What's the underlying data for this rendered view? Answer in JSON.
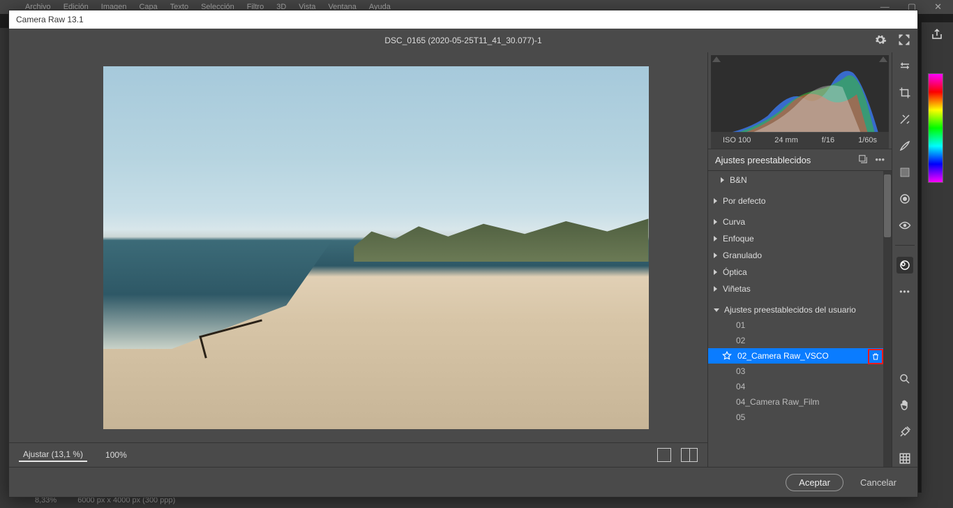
{
  "app": {
    "menubar": [
      "Archivo",
      "Edición",
      "Imagen",
      "Capa",
      "Texto",
      "Selección",
      "Filtro",
      "3D",
      "Vista",
      "Ventana",
      "Ayuda"
    ],
    "window_controls": [
      "—",
      "▢",
      "✕"
    ]
  },
  "bottom_status": {
    "zoom": "8,33%",
    "dims": "6000 px x 4000 px (300 ppp)"
  },
  "cr": {
    "title": "Camera Raw 13.1",
    "filename": "DSC_0165 (2020-05-25T11_41_30.077)-1",
    "exif": {
      "iso": "ISO 100",
      "focal": "24 mm",
      "aperture": "f/16",
      "shutter": "1/60s"
    },
    "panel_title": "Ajustes preestablecidos",
    "truncated_row": "B&N",
    "groups": [
      "Por defecto",
      "Curva",
      "Enfoque",
      "Granulado",
      "Óptica",
      "Viñetas"
    ],
    "user_group": "Ajustes preestablecidos del usuario",
    "presets": [
      "01",
      "02",
      "02_Camera Raw_VSCO",
      "03",
      "04",
      "04_Camera Raw_Film",
      "05"
    ],
    "selected_preset_index": 2,
    "bottom": {
      "fit": "Ajustar (13,1 %)",
      "zoom": "100%"
    },
    "footer": {
      "accept": "Aceptar",
      "cancel": "Cancelar"
    }
  }
}
